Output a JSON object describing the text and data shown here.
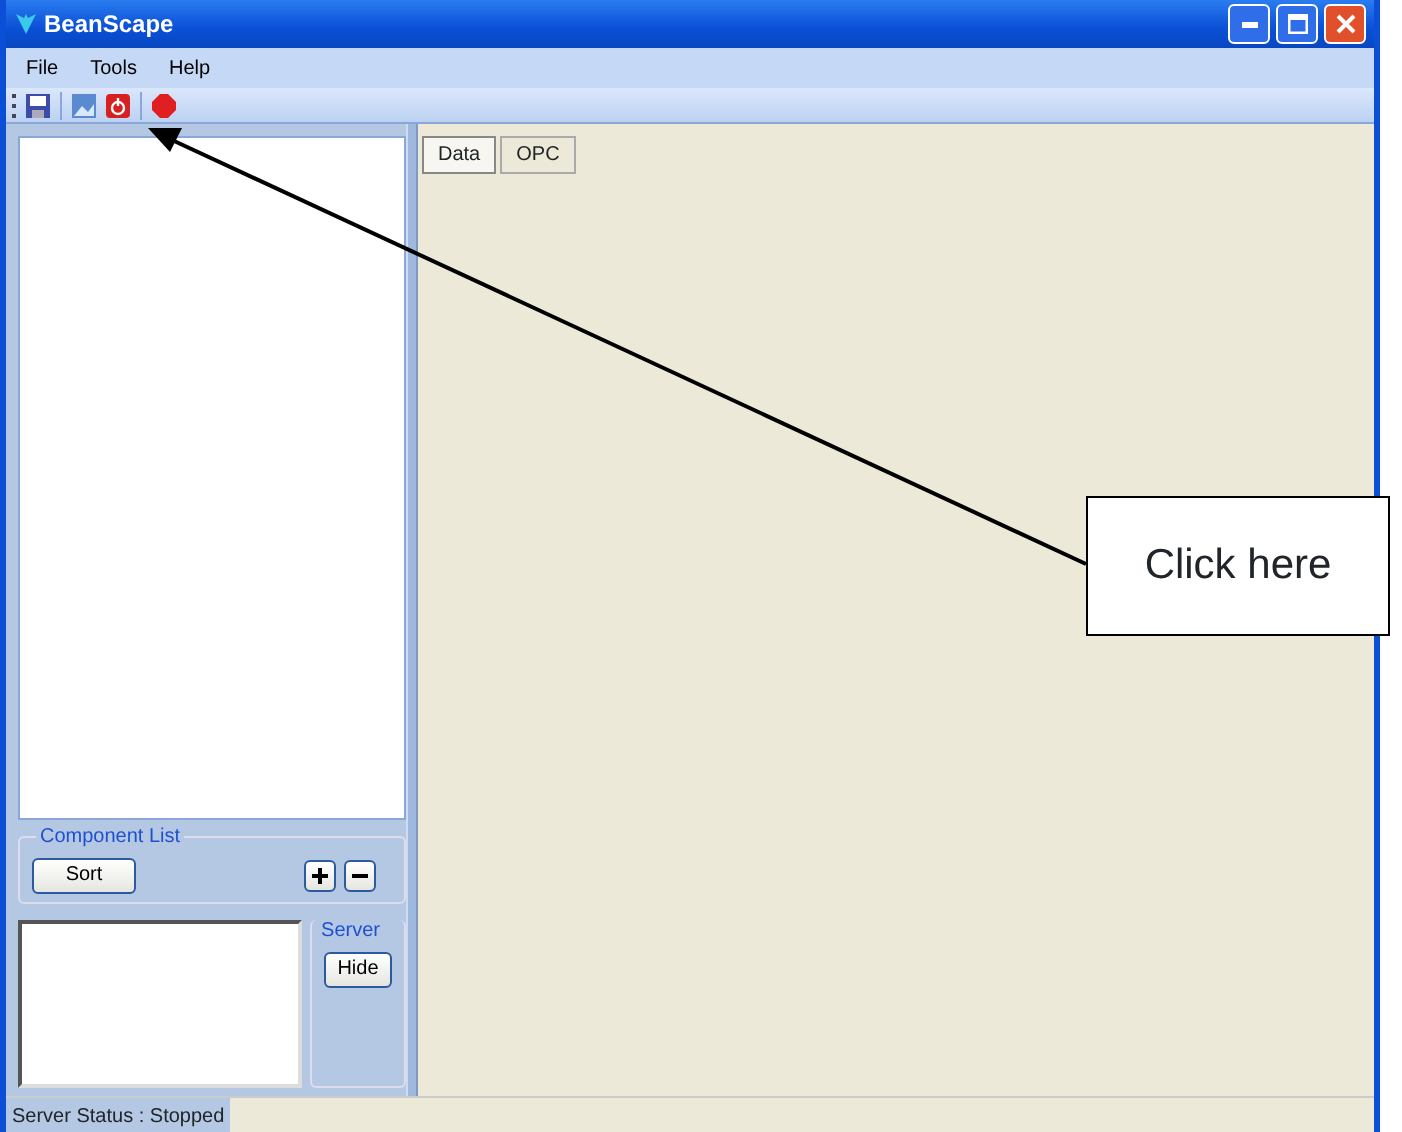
{
  "window": {
    "title": "BeanScape"
  },
  "menu": [
    "File",
    "Tools",
    "Help"
  ],
  "tabs": [
    {
      "label": "Data",
      "selected": true
    },
    {
      "label": "OPC",
      "selected": false
    }
  ],
  "component_list": {
    "title": "Component List",
    "sort_button": "Sort"
  },
  "server": {
    "title": "Server",
    "hide_button": "Hide"
  },
  "status_bar": "Server Status : Stopped",
  "callout": {
    "text": "Click here"
  }
}
